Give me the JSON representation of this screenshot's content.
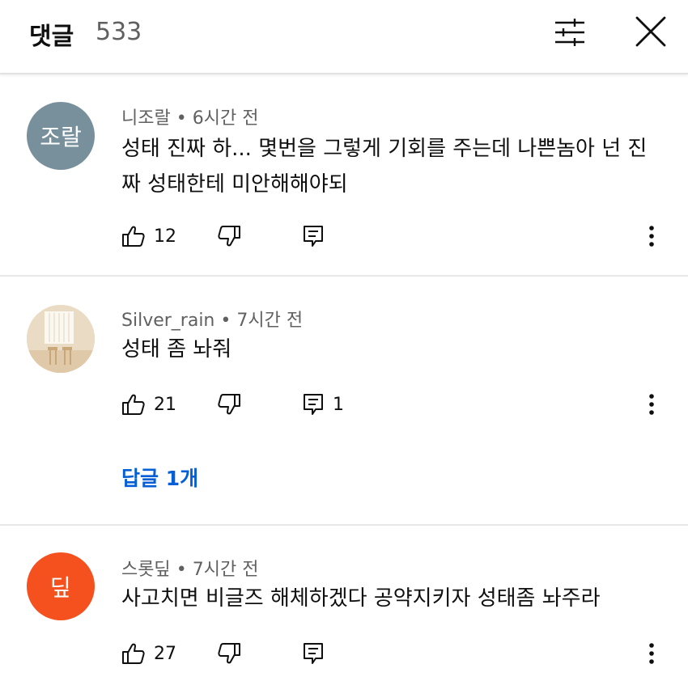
{
  "header": {
    "title": "댓글",
    "count": "533",
    "filter_icon": "sliders-icon",
    "close_icon": "close-icon"
  },
  "comments": [
    {
      "avatar_text": "조랄",
      "avatar_color": "#78909c",
      "author": "니조랄",
      "time": "6시간 전",
      "text": "성태 진짜 하... 몇번을 그렇게 기회를 주는데 나쁜놈아 넌 진짜 성태한테 미안해해야되",
      "likes": "12",
      "replies": ""
    },
    {
      "avatar_text": "",
      "avatar_color": "#e9d9c3",
      "author": "Silver_rain",
      "time": "7시간 전",
      "text": "성태 좀 놔줘",
      "likes": "21",
      "replies": "1",
      "reply_link": "답글 1개"
    },
    {
      "avatar_text": "딮",
      "avatar_color": "#f4511e",
      "author": "스롯딮",
      "time": "7시간 전",
      "text": "사고치면 비글즈 해체하겠다 공약지키자 성태좀 놔주라",
      "likes": "27",
      "replies": ""
    }
  ],
  "colors": {
    "link": "#065fd4",
    "secondary_text": "#606060",
    "divider": "#e8e8e8"
  }
}
